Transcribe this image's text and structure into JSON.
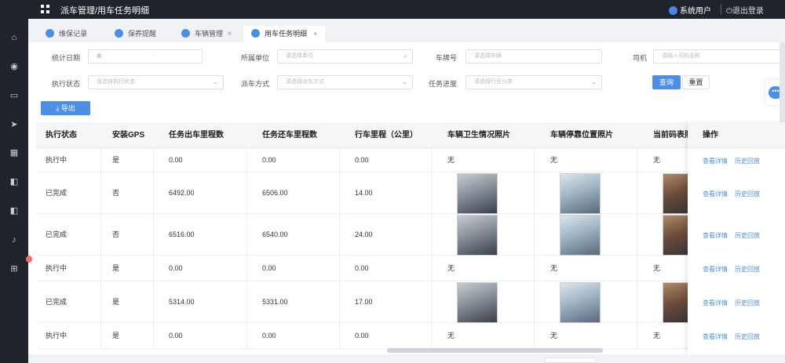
{
  "topbar": {
    "breadcrumb": "派车管理/用车任务明细",
    "user": "系统用户",
    "logout": "退出登录"
  },
  "tabs": [
    {
      "label": "维保记录",
      "icon": "wrench-icon"
    },
    {
      "label": "保养提醒",
      "icon": "bell-icon"
    },
    {
      "label": "车辆管理",
      "icon": "car-icon"
    },
    {
      "label": "用车任务明细",
      "icon": "send-icon",
      "active": true,
      "close": "×"
    }
  ],
  "filters": {
    "stat_date": {
      "label": "统计日期",
      "separator": "-"
    },
    "unit": {
      "label": "所属单位",
      "placeholder": "请选择单位"
    },
    "plate": {
      "label": "车牌号",
      "placeholder": "请选择车辆"
    },
    "driver": {
      "label": "司机",
      "placeholder": "请输入司机名称"
    },
    "exec_status": {
      "label": "执行状态",
      "placeholder": "请选择执行状态"
    },
    "dispatch": {
      "label": "派车方式",
      "placeholder": "请选择派车方式"
    },
    "progress": {
      "label": "任务进度",
      "placeholder": "请选择行业分类"
    },
    "search_btn": "查询",
    "reset_btn": "重置",
    "export_btn": "导出"
  },
  "table": {
    "columns": [
      "执行状态",
      "安装GPS",
      "任务出车里程数",
      "任务还车里程数",
      "行车里程（公里）",
      "车辆卫生情况照片",
      "车辆停靠位置照片",
      "当前码表照片"
    ],
    "op_header": "操作",
    "rows": [
      {
        "status": "执行中",
        "gps": "是",
        "out": "0.00",
        "back": "0.00",
        "dist": "0.00",
        "hygiene": "无",
        "parking": "无",
        "meter": "无",
        "has_photo": false
      },
      {
        "status": "已完成",
        "gps": "否",
        "out": "6492.00",
        "back": "6506.00",
        "dist": "14.00",
        "hygiene": "",
        "parking": "",
        "meter": "",
        "has_photo": true
      },
      {
        "status": "已完成",
        "gps": "否",
        "out": "6516.00",
        "back": "6540.00",
        "dist": "24.00",
        "hygiene": "",
        "parking": "",
        "meter": "",
        "has_photo": true
      },
      {
        "status": "执行中",
        "gps": "是",
        "out": "0.00",
        "back": "0.00",
        "dist": "0.00",
        "hygiene": "无",
        "parking": "无",
        "meter": "无",
        "has_photo": false
      },
      {
        "status": "已完成",
        "gps": "是",
        "out": "5314.00",
        "back": "5331.00",
        "dist": "17.00",
        "hygiene": "",
        "parking": "",
        "meter": "",
        "has_photo": true
      },
      {
        "status": "执行中",
        "gps": "是",
        "out": "0.00",
        "back": "0.00",
        "dist": "0.00",
        "hygiene": "无",
        "parking": "无",
        "meter": "无",
        "has_photo": false
      }
    ],
    "actions": {
      "detail": "查看详情",
      "history": "历史回放"
    }
  }
}
